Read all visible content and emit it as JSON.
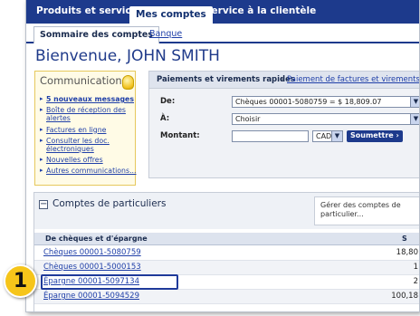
{
  "topnav": {
    "items": [
      {
        "label": "Produits et services"
      },
      {
        "label": "Mes comptes"
      },
      {
        "label": "Service à la clientèle"
      }
    ]
  },
  "subnav": {
    "items": [
      {
        "label": "Sommaire des comptes"
      },
      {
        "label": "Banque"
      }
    ]
  },
  "welcome": "Bienvenue, JOHN SMITH",
  "communications": {
    "title": "Communications",
    "icon": "lightbulb-icon",
    "items": [
      {
        "label": "5 nouveaux messages"
      },
      {
        "label": "Boîte de réception des alertes"
      },
      {
        "label": "Factures en ligne"
      },
      {
        "label": "Consulter les doc. électroniques"
      },
      {
        "label": "Nouvelles offres"
      },
      {
        "label": "Autres communications..."
      }
    ]
  },
  "payments": {
    "title": "Paiements et virements rapides",
    "link": "Paiement de factures et virements de",
    "from_label": "De:",
    "from_value": "Chèques 00001-5080759 = $ 18,809.07",
    "to_label": "À:",
    "to_value": "Choisir",
    "amount_label": "Montant:",
    "amount_value": "",
    "currency": "CAD",
    "submit_label": "Soumettre ›"
  },
  "accounts": {
    "title": "Comptes de particuliers",
    "manage_text": "Gérer des comptes de particulier...",
    "table_header": "De chèques et d'épargne",
    "balance_header": "S",
    "rows": [
      {
        "name": "Chèques 00001-5080759",
        "balance": "18,80"
      },
      {
        "name": "Chèques 00001-5000153",
        "balance": "1"
      },
      {
        "name": "Épargne 00001-5097134",
        "balance": "2"
      },
      {
        "name": "Épargne 00001-5094529",
        "balance": "100,18"
      }
    ]
  },
  "callout": {
    "number": "1"
  }
}
